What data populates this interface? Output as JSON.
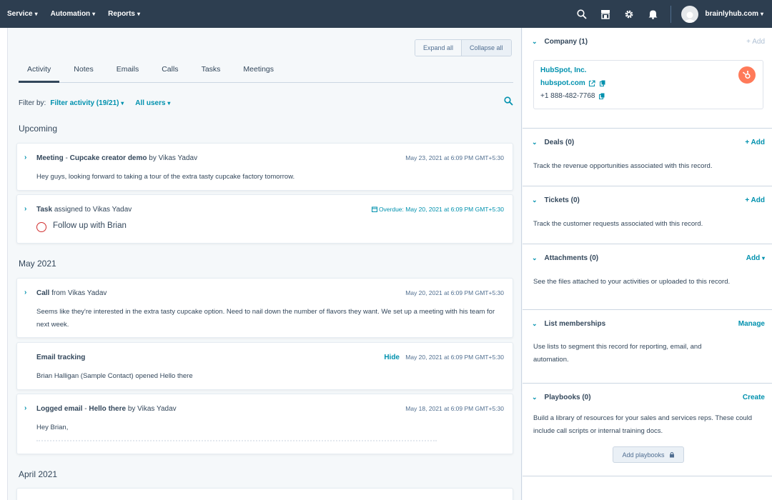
{
  "nav": {
    "menus": [
      "Service",
      "Automation",
      "Reports"
    ],
    "account": "brainlyhub.com"
  },
  "toolbar": {
    "expand_all": "Expand all",
    "collapse_all": "Collapse all"
  },
  "tabs": [
    "Activity",
    "Notes",
    "Emails",
    "Calls",
    "Tasks",
    "Meetings"
  ],
  "filter": {
    "label": "Filter by:",
    "activity": "Filter activity (19/21)",
    "users": "All users"
  },
  "sections": {
    "upcoming": "Upcoming",
    "may": "May 2021",
    "april": "April 2021"
  },
  "activities": {
    "meeting": {
      "type": "Meeting",
      "title": "Cupcake creator demo",
      "by": "by Vikas Yadav",
      "date": "May 23, 2021 at 6:09 PM GMT+5:30",
      "body": "Hey guys, looking forward to taking a tour of the extra tasty cupcake factory tomorrow."
    },
    "task": {
      "type": "Task",
      "assigned": "assigned to Vikas Yadav",
      "overdue": "Overdue: May 20, 2021 at 6:09 PM GMT+5:30",
      "text": "Follow up with Brian"
    },
    "call": {
      "type": "Call",
      "from": "from Vikas Yadav",
      "date": "May 20, 2021 at 6:09 PM GMT+5:30",
      "body": "Seems like they're interested in the extra tasty cupcake option. Need to nail down the number of flavors they want. We set up a meeting with his team for next week."
    },
    "tracking": {
      "type": "Email tracking",
      "hide": "Hide",
      "date": "May 20, 2021 at 6:09 PM GMT+5:30",
      "body": "Brian Halligan (Sample Contact) opened Hello there"
    },
    "logged": {
      "type": "Logged email",
      "title": "Hello there",
      "by": "by Vikas Yadav",
      "date": "May 18, 2021 at 6:09 PM GMT+5:30",
      "body": "Hey Brian,"
    }
  },
  "sidebar": {
    "company": {
      "title": "Company (1)",
      "action": "+ Add",
      "name": "HubSpot, Inc.",
      "domain": "hubspot.com",
      "phone": "+1 888-482-7768"
    },
    "deals": {
      "title": "Deals (0)",
      "action": "+ Add",
      "desc": "Track the revenue opportunities associated with this record."
    },
    "tickets": {
      "title": "Tickets (0)",
      "action": "+ Add",
      "desc": "Track the customer requests associated with this record."
    },
    "attachments": {
      "title": "Attachments (0)",
      "action": "Add",
      "desc": "See the files attached to your activities or uploaded to this record."
    },
    "lists": {
      "title": "List memberships",
      "action": "Manage",
      "desc": "Use lists to segment this record for reporting, email, and automation."
    },
    "playbooks": {
      "title": "Playbooks (0)",
      "action": "Create",
      "desc": "Build a library of resources for your sales and services reps. These could include call scripts or internal training docs.",
      "button": "Add playbooks"
    }
  },
  "colors": {
    "nav_bg": "#2d3e50",
    "link": "#0091ae",
    "text": "#33475b",
    "overdue_circle": "#d12e2e",
    "brand": "#ff7a59"
  },
  "icons": [
    "search-icon",
    "marketplace-icon",
    "gear-icon",
    "bell-icon",
    "avatar",
    "copy-icon",
    "external-link-icon",
    "calendar-icon",
    "lock-icon",
    "hubspot-logo"
  ]
}
